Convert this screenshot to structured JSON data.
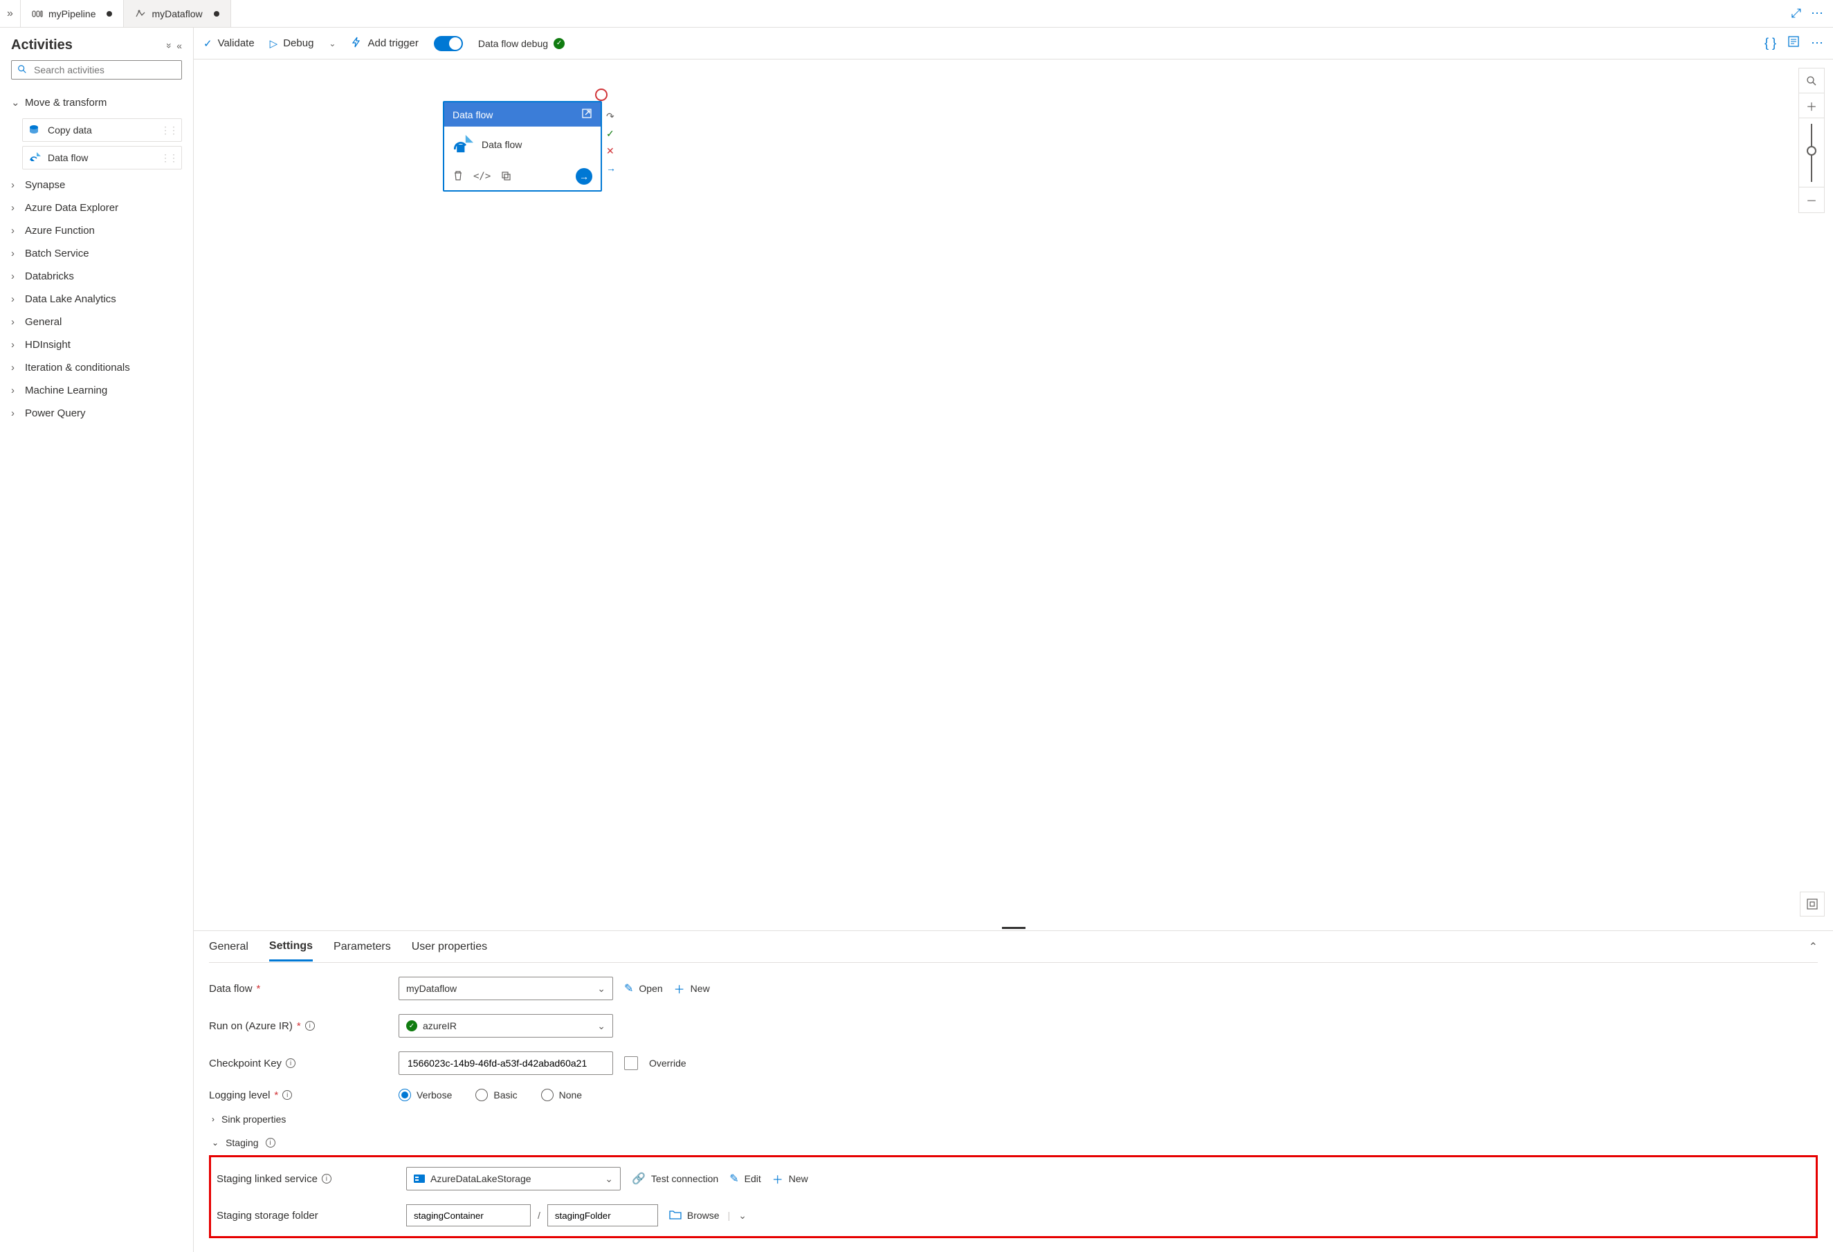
{
  "tabs": [
    {
      "label": "myPipeline",
      "dirty": true,
      "active": true
    },
    {
      "label": "myDataflow",
      "dirty": true,
      "active": false
    }
  ],
  "sidebar": {
    "title": "Activities",
    "search_placeholder": "Search activities",
    "categories": {
      "move_transform": "Move & transform",
      "items": {
        "copy": "Copy data",
        "dataflow": "Data flow"
      },
      "rest": [
        "Synapse",
        "Azure Data Explorer",
        "Azure Function",
        "Batch Service",
        "Databricks",
        "Data Lake Analytics",
        "General",
        "HDInsight",
        "Iteration & conditionals",
        "Machine Learning",
        "Power Query"
      ]
    }
  },
  "toolbar": {
    "validate": "Validate",
    "debug": "Debug",
    "add_trigger": "Add trigger",
    "debug_toggle": "Data flow debug"
  },
  "canvas": {
    "node_type": "Data flow",
    "node_name": "Data flow"
  },
  "props": {
    "tabs": {
      "general": "General",
      "settings": "Settings",
      "parameters": "Parameters",
      "user": "User properties"
    },
    "labels": {
      "dataflow": "Data flow",
      "runon": "Run on (Azure IR)",
      "checkpoint": "Checkpoint Key",
      "logging": "Logging level",
      "sink": "Sink properties",
      "staging": "Staging",
      "staging_service": "Staging linked service",
      "staging_folder": "Staging storage folder"
    },
    "values": {
      "dataflow": "myDataflow",
      "runon": "azureIR",
      "checkpoint": "1566023c-14b9-46fd-a53f-d42abad60a21",
      "staging_service": "AzureDataLakeStorage",
      "container": "stagingContainer",
      "folder": "stagingFolder"
    },
    "actions": {
      "open": "Open",
      "new": "New",
      "override": "Override",
      "verbose": "Verbose",
      "basic": "Basic",
      "none": "None",
      "test": "Test connection",
      "edit": "Edit",
      "browse": "Browse"
    }
  }
}
